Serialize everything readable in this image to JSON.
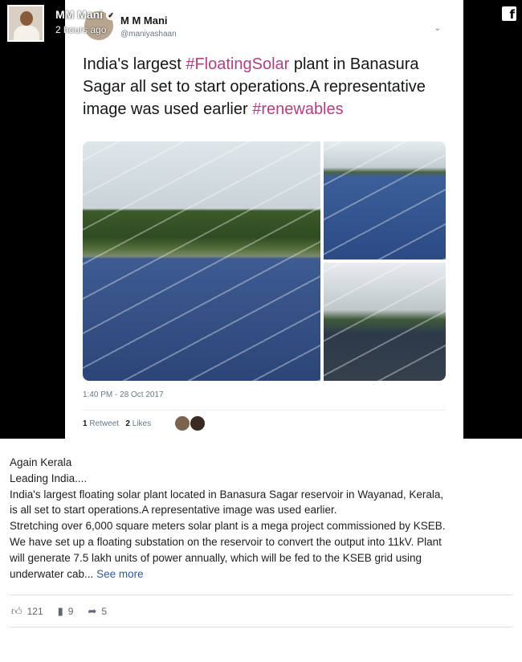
{
  "post": {
    "author": "MM Mani",
    "time": "2 hours ago",
    "platform_icon": "facebook-icon",
    "verified_icon": "verified-badge-icon"
  },
  "tweet": {
    "name": "M M Mani",
    "handle": "@maniyashaan",
    "text_parts": [
      "India's largest ",
      "#FloatingSolar",
      " plant in Banasura Sagar all set to start operations.A representative image was used earlier ",
      "#renewables"
    ],
    "timestamp": "1:40 PM - 28 Oct 2017",
    "retweets_count": "1",
    "retweets_label": "Retweet",
    "likes_count": "2",
    "likes_label": "Likes",
    "photo_subjects": [
      "floating solar panels near hills",
      "solar panel array",
      "solar panels under cloudy sky"
    ]
  },
  "caption": {
    "lines": [
      "Again Kerala",
      "Leading India....",
      "India's largest floating solar plant located in Banasura Sagar reservoir in Wayanad, Kerala,",
      "is all set to start operations.A representative image was used earlier.",
      "Stretching over 6,000 square meters solar plant is a mega project commissioned by KSEB.",
      "We have set up a floating substation on the reservoir to convert the output into 11kV. Plant",
      "will generate 7.5 lakh units of power annually, which will be fed to the KSEB grid using"
    ],
    "last_line": "underwater cab...",
    "see_more": "See more"
  },
  "footer": {
    "likes": "121",
    "comments": "9",
    "shares": "5",
    "icons": [
      "like-icon",
      "comment-icon",
      "share-icon"
    ]
  },
  "colors": {
    "hashtag": "#b0417f",
    "link": "#385898",
    "media_background": "#000000"
  }
}
